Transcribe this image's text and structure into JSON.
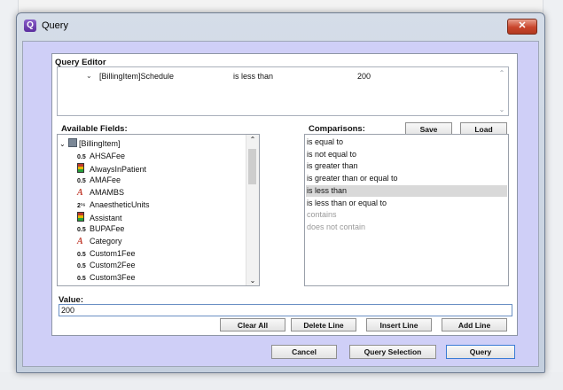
{
  "window": {
    "title": "Query",
    "icon": "query-app-icon",
    "close_glyph": "✕"
  },
  "query_editor": {
    "title": "Query Editor",
    "line": {
      "field": "[BillingItem]Schedule",
      "comparison": "is less than",
      "value": "200"
    }
  },
  "available_fields": {
    "label": "Available Fields:",
    "root": "[BillingItem]",
    "items": [
      {
        "type": "0.5",
        "name": "AHSAFee"
      },
      {
        "type": "bool",
        "name": "AlwaysInPatient"
      },
      {
        "type": "0.5",
        "name": "AMAFee"
      },
      {
        "type": "text",
        "name": "AMAMBS"
      },
      {
        "type": "2¹⁶",
        "name": "AnaestheticUnits"
      },
      {
        "type": "bool",
        "name": "Assistant"
      },
      {
        "type": "0.5",
        "name": "BUPAFee"
      },
      {
        "type": "text",
        "name": "Category"
      },
      {
        "type": "0.5",
        "name": "Custom1Fee"
      },
      {
        "type": "0.5",
        "name": "Custom2Fee"
      },
      {
        "type": "0.5",
        "name": "Custom3Fee"
      }
    ]
  },
  "comparisons": {
    "label": "Comparisons:",
    "items": [
      {
        "label": "is equal to",
        "state": "normal"
      },
      {
        "label": "is not equal to",
        "state": "normal"
      },
      {
        "label": "is greater than",
        "state": "normal"
      },
      {
        "label": "is greater than or equal to",
        "state": "normal"
      },
      {
        "label": "is less than",
        "state": "selected"
      },
      {
        "label": "is less than or equal to",
        "state": "normal"
      },
      {
        "label": "contains",
        "state": "disabled"
      },
      {
        "label": "does not contain",
        "state": "disabled"
      }
    ]
  },
  "buttons": {
    "save": "Save",
    "load": "Load",
    "clear_all": "Clear All",
    "delete_line": "Delete Line",
    "insert_line": "Insert Line",
    "add_line": "Add Line",
    "cancel": "Cancel",
    "query_selection": "Query Selection",
    "query": "Query"
  },
  "value": {
    "label": "Value:",
    "current": "200"
  },
  "colors": {
    "client_bg": "#cfcff7",
    "selection": "#d9d9d9",
    "input_border": "#6a90c4"
  }
}
